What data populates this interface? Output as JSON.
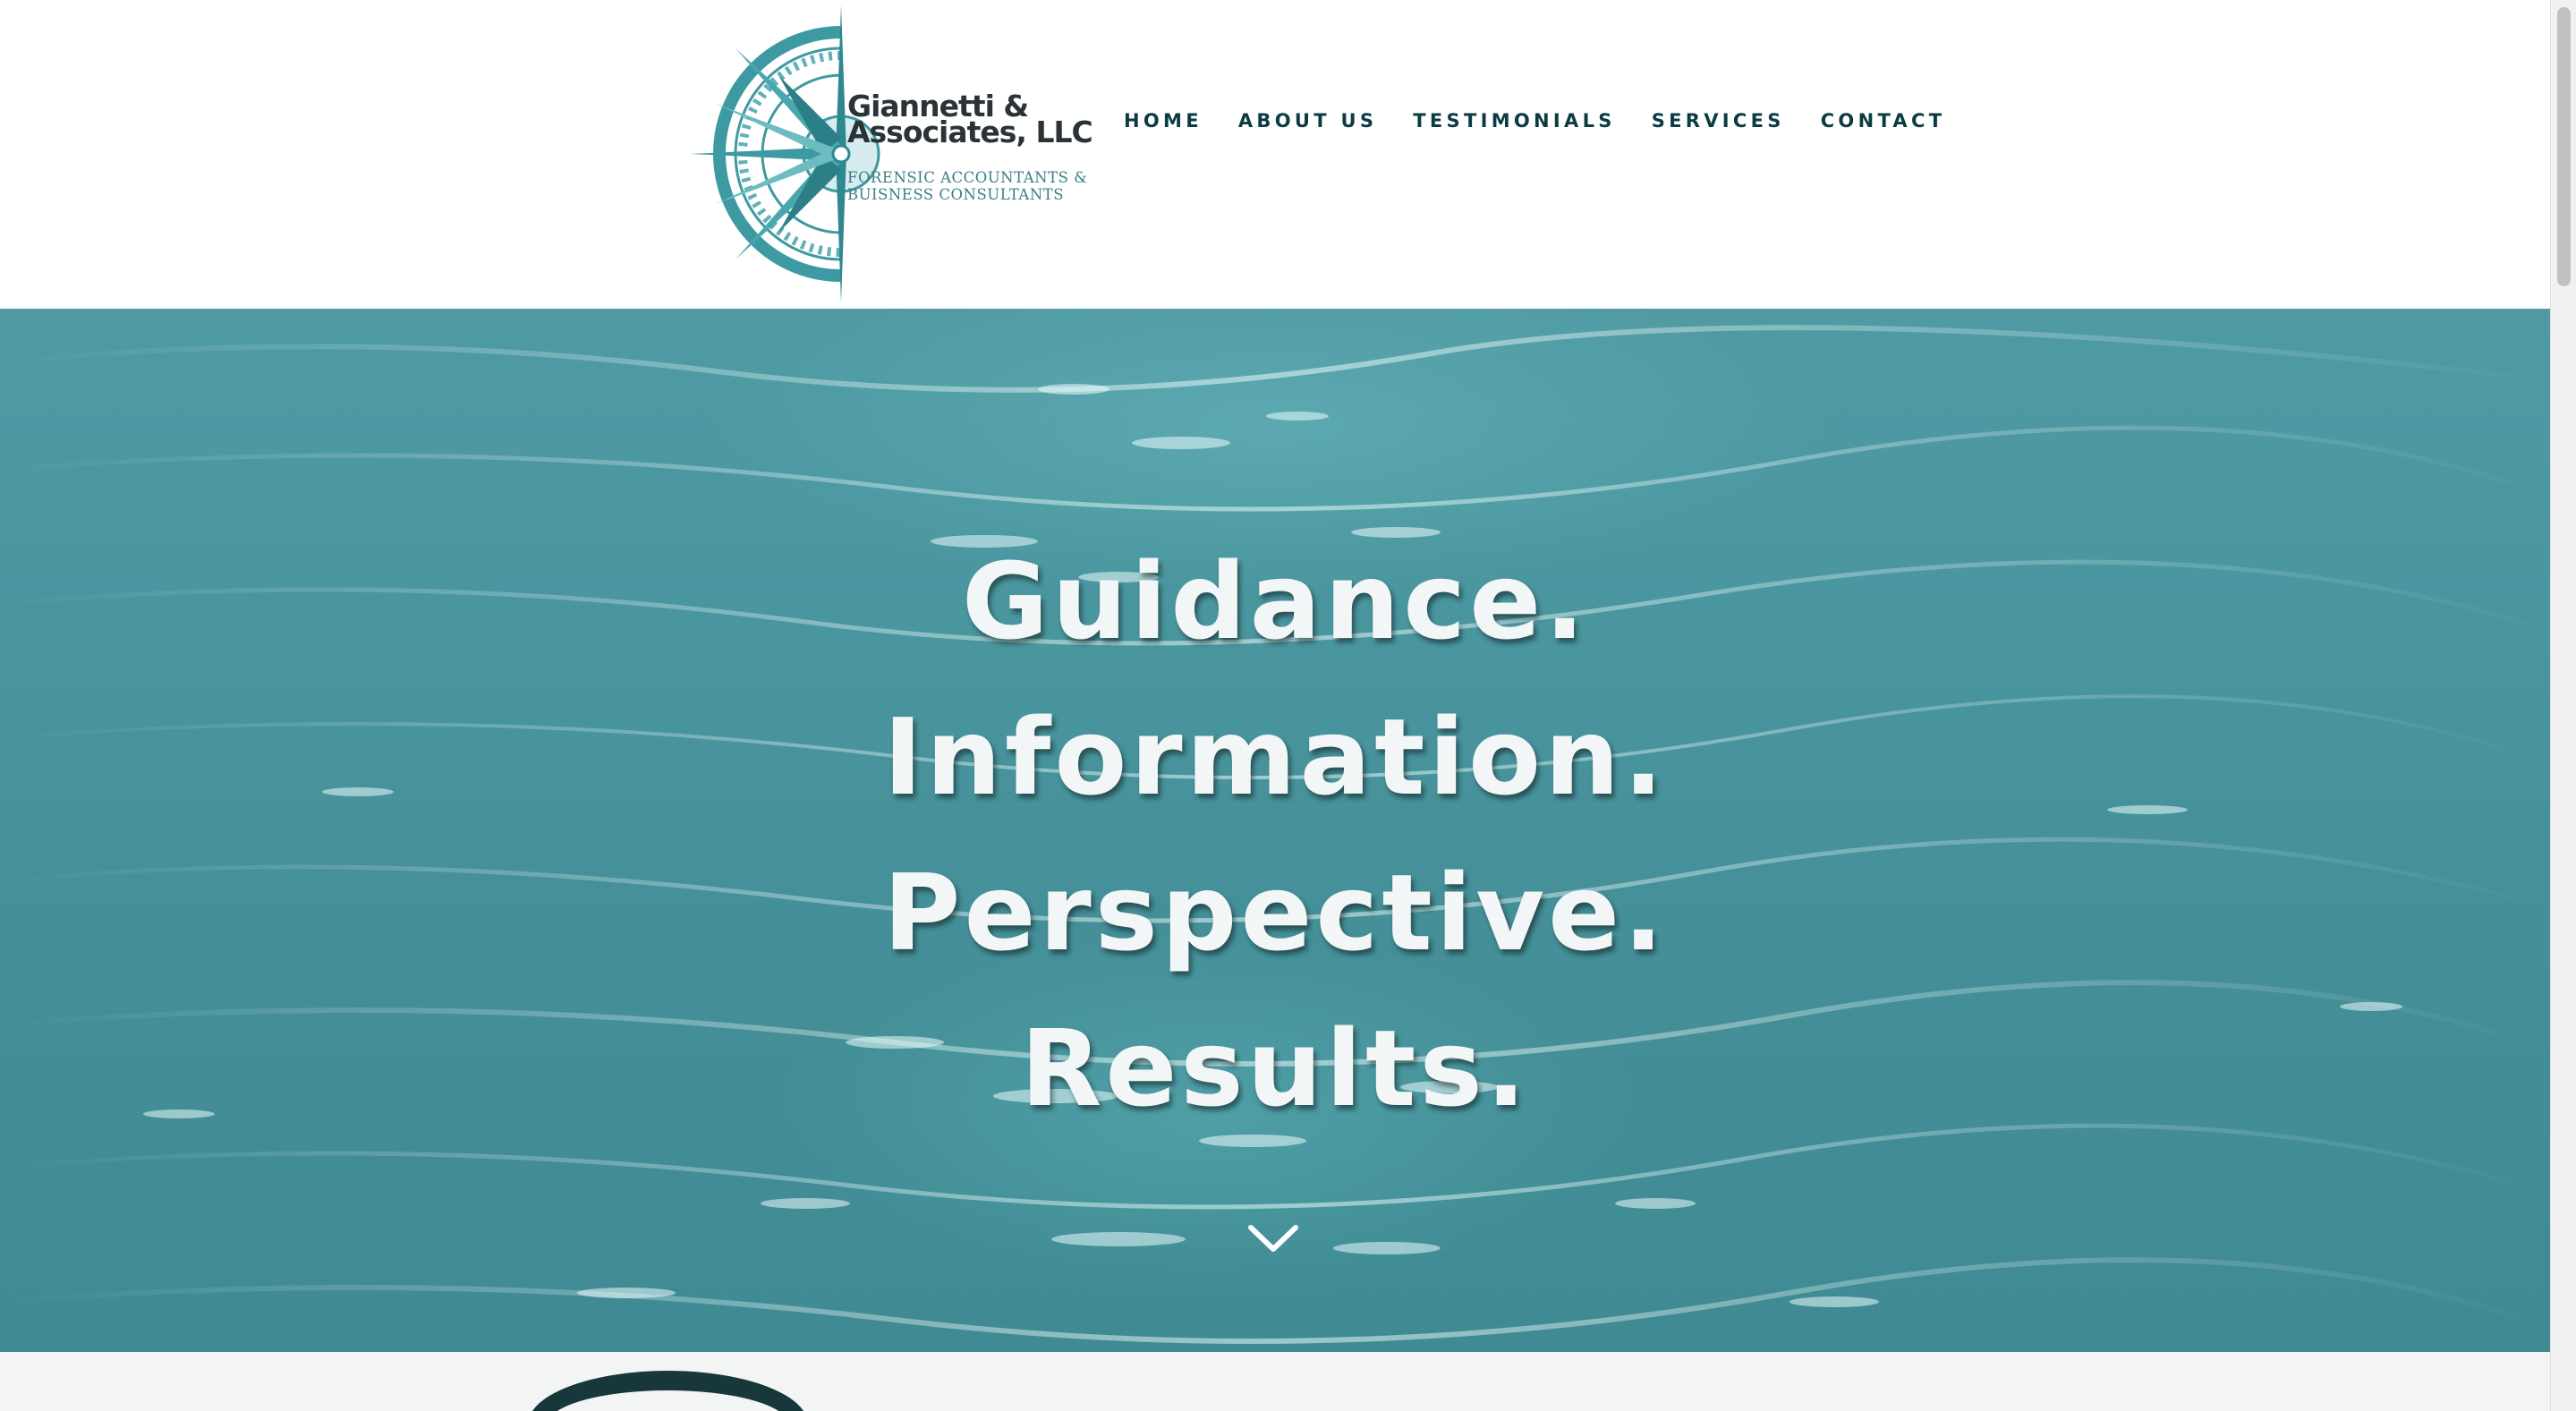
{
  "brand": {
    "name_line1": "Giannetti &",
    "name_line2": "Associates, LLC",
    "tagline_line1": "FORENSIC ACCOUNTANTS &",
    "tagline_line2": "BUISNESS CONSULTANTS",
    "logo_icon": "compass-rose-icon",
    "accent_color": "#3e9aa2"
  },
  "nav": {
    "items": [
      {
        "label": "HOME"
      },
      {
        "label": "ABOUT US"
      },
      {
        "label": "TESTIMONIALS"
      },
      {
        "label": "SERVICES"
      },
      {
        "label": "CONTACT"
      }
    ],
    "text_color": "#0d3b43"
  },
  "hero": {
    "lines": [
      "Guidance.",
      "Information.",
      "Perspective.",
      "Results."
    ],
    "background_color": "#4a969f",
    "scroll_icon": "chevron-down-icon"
  }
}
